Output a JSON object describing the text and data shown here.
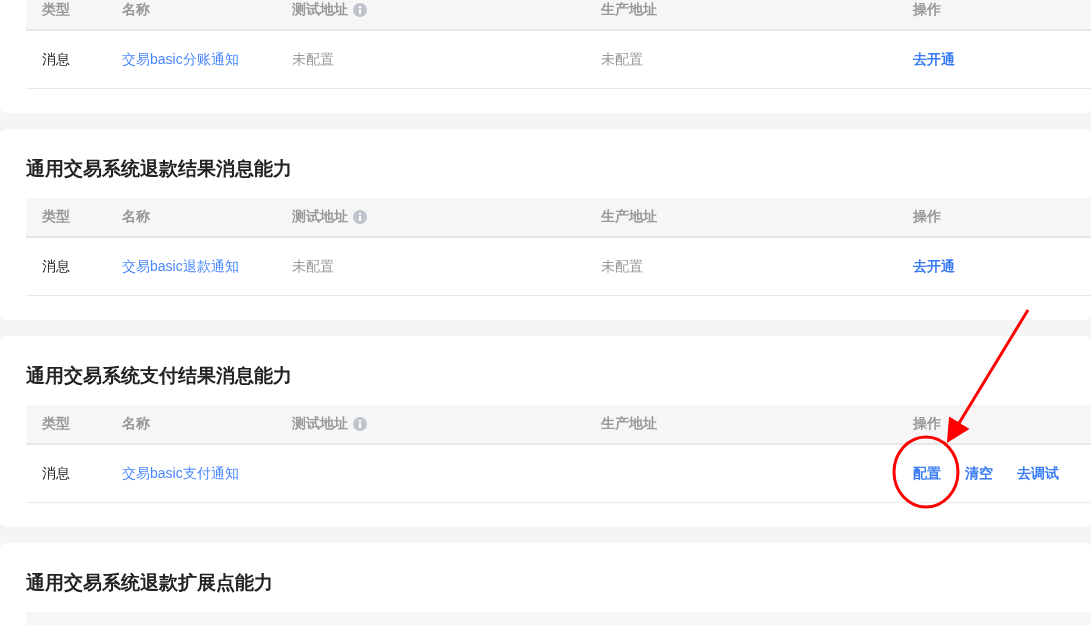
{
  "sections": [
    {
      "columns": [
        {
          "label": "类型",
          "info": false
        },
        {
          "label": "名称",
          "info": false
        },
        {
          "label": "测试地址",
          "info": true
        },
        {
          "label": "生产地址",
          "info": false
        },
        {
          "label": "操作",
          "info": false
        }
      ],
      "rows": [
        {
          "type": "消息",
          "name": "交易basic分账通知",
          "test_address": "未配置",
          "prod_address": "未配置",
          "actions": [
            "去开通"
          ]
        }
      ]
    },
    {
      "title": "通用交易系统退款结果消息能力",
      "columns": [
        {
          "label": "类型",
          "info": false
        },
        {
          "label": "名称",
          "info": false
        },
        {
          "label": "测试地址",
          "info": true
        },
        {
          "label": "生产地址",
          "info": false
        },
        {
          "label": "操作",
          "info": false
        }
      ],
      "rows": [
        {
          "type": "消息",
          "name": "交易basic退款通知",
          "test_address": "未配置",
          "prod_address": "未配置",
          "actions": [
            "去开通"
          ]
        }
      ]
    },
    {
      "title": "通用交易系统支付结果消息能力",
      "columns": [
        {
          "label": "类型",
          "info": false
        },
        {
          "label": "名称",
          "info": false
        },
        {
          "label": "测试地址",
          "info": true
        },
        {
          "label": "生产地址",
          "info": false
        },
        {
          "label": "操作",
          "info": false
        }
      ],
      "rows": [
        {
          "type": "消息",
          "name": "交易basic支付通知",
          "actions": [
            "配置",
            "清空",
            "去调试"
          ]
        }
      ]
    },
    {
      "title": "通用交易系统退款扩展点能力"
    }
  ]
}
